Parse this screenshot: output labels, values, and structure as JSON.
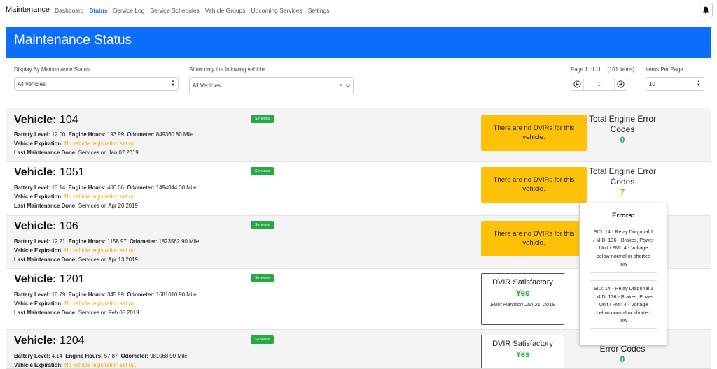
{
  "nav": {
    "brand": "Maintenance",
    "links": [
      "Dashboard",
      "Status",
      "Service Log",
      "Service Schedules",
      "Vehicle Groups",
      "Upcoming Services",
      "Settings"
    ],
    "active": "Status"
  },
  "page": {
    "title": "Maintenance Status"
  },
  "filters": {
    "status_label": "Display By Maintenance Status",
    "status_value": "All Vehicles",
    "vehicle_label": "Show only the following vehicle",
    "vehicle_value": "All Vehicles",
    "page_info": "Page 1 of 11",
    "items_info": "(101 items)",
    "current_page": "1",
    "per_page_label": "Items Per Page",
    "per_page_value": "10"
  },
  "labels": {
    "vehicle_prefix": "Vehicle:",
    "battery": "Battery Level:",
    "engine": "Engine Hours:",
    "odometer": "Odometer:",
    "expiration": "Vehicle Expiration:",
    "last_maint": "Last Maintenance Done:",
    "services_badge": "Services",
    "total_codes": "Total Engine Error Codes",
    "errors_title": "Errors:"
  },
  "vehicles": [
    {
      "id": "104",
      "battery": "12.00",
      "engine_hours": "193.99",
      "odometer": "849360.80 Mile",
      "expiration": "No vehicle registration set up.",
      "last_maintenance": "Services on Jan 07 2019",
      "dvir": "There are no DVIRs for this vehicle.",
      "error_codes": "0"
    },
    {
      "id": "1051",
      "battery": "13.14",
      "engine_hours": "400.06",
      "odometer": "1494044.30 Mile",
      "expiration": "No vehicle registration set up.",
      "last_maintenance": "Services on Apr 20 2019",
      "dvir": "There are no DVIRs for this vehicle.",
      "error_codes": "7"
    },
    {
      "id": "106",
      "battery": "12.21",
      "engine_hours": "1158.97",
      "odometer": "1823562.90 Mile",
      "expiration": "No vehicle registration set up.",
      "last_maintenance": "Services on Apr 13 2019",
      "dvir": "There are no DVIRs for this vehicle."
    },
    {
      "id": "1201",
      "battery": "10.79",
      "engine_hours": "345.99",
      "odometer": "1681010.90 Mile",
      "expiration": "No vehicle registration set up.",
      "last_maintenance": "Services on Feb 08 2019",
      "dvir_title": "DVIR Satisfactory",
      "dvir_status": "Yes",
      "dvir_by": "Elliot Harrison Jan 21, 2019"
    },
    {
      "id": "1204",
      "battery": "4.14",
      "engine_hours": "57.87",
      "odometer": "981068.90 Mile",
      "expiration": "No vehicle registration set up.",
      "dvir_title": "DVIR Satisfactory",
      "dvir_status": "Yes",
      "error_codes_title": "Error Codes",
      "error_codes": "0"
    }
  ],
  "popover": {
    "title": "Errors:",
    "errors": [
      "SID: 14 - Relay Diagonal 1 / MID: 136 - Brakes, Power Unit / FMI: 4 - Voltage below normal or shorted low",
      "SID: 14 - Relay Diagonal 1 / MID: 136 - Brakes, Power Unit / FMI: 4 - Voltage below normal or shorted low"
    ]
  },
  "colors": {
    "header": "#0b6ffb",
    "nav_active": "#1a6fd8",
    "warning": "#f0a500",
    "dvir_none": "#ffc107",
    "success": "#28a745",
    "codes_warning": "#d98e04"
  }
}
